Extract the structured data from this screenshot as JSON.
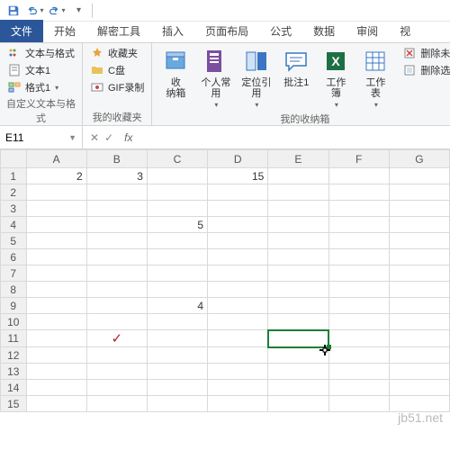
{
  "qat": {
    "save": "保存",
    "undo": "撤销",
    "redo": "重做",
    "custom": "自定义"
  },
  "tabs": [
    "文件",
    "开始",
    "解密工具",
    "插入",
    "页面布局",
    "公式",
    "数据",
    "审阅",
    "视"
  ],
  "activeTab": 0,
  "ribbon": {
    "g1": {
      "label": "自定义文本与格式",
      "items": [
        "文本与格式",
        "文本1",
        "格式1"
      ]
    },
    "g2": {
      "label": "我的收藏夹",
      "items": [
        "收藏夹",
        "C盘",
        "GIF录制"
      ]
    },
    "g3": {
      "label": "我的收纳箱",
      "btns": [
        "收\n纳箱",
        "个人常\n用",
        "定位引\n用",
        "批注1",
        "工作\n簿",
        "工作\n表"
      ],
      "side": [
        "删除未",
        "删除选"
      ]
    }
  },
  "nameBox": "E11",
  "formula": "",
  "cols": [
    "A",
    "B",
    "C",
    "D",
    "E",
    "F",
    "G"
  ],
  "rows": 15,
  "cells": {
    "A1": "2",
    "B1": "3",
    "D1": "15",
    "C4": "5",
    "C9": "4",
    "B11": "✓"
  },
  "selected": "E11",
  "watermark": "jb51.net"
}
